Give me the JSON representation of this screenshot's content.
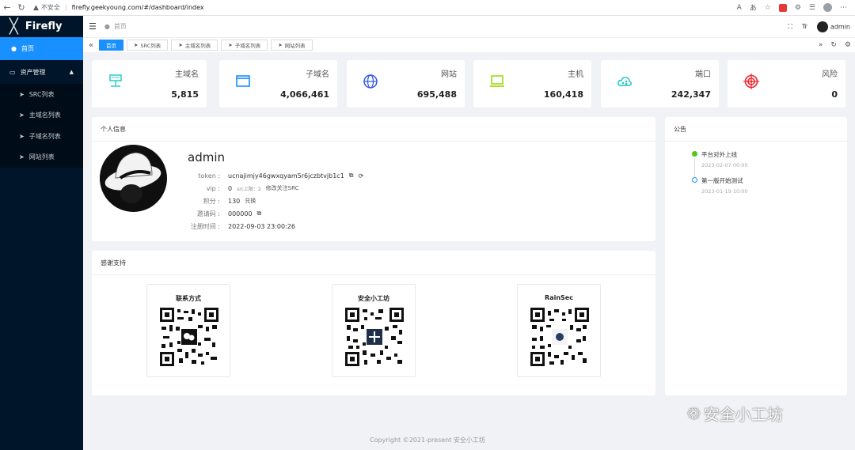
{
  "browser": {
    "back": "←",
    "reload": "↻",
    "warn": "▲",
    "insecure": "不安全",
    "url": "firefly.geekyoung.com/#/dashboard/index"
  },
  "sidebar": {
    "brand": "Firefly",
    "home": "首页",
    "group": "资产管理",
    "items": [
      {
        "label": "SRC列表"
      },
      {
        "label": "主域名列表"
      },
      {
        "label": "子域名列表"
      },
      {
        "label": "网站列表"
      }
    ]
  },
  "header": {
    "breadcrumb": "首页",
    "user": "admin",
    "tr": "Tr"
  },
  "tabs": [
    {
      "label": "首页",
      "active": true
    },
    {
      "label": "SRC列表"
    },
    {
      "label": "主域名列表"
    },
    {
      "label": "子域名列表"
    },
    {
      "label": "网站列表"
    }
  ],
  "stats": [
    {
      "label": "主域名",
      "value": "5,815",
      "color": "#36cfc9"
    },
    {
      "label": "子域名",
      "value": "4,066,461",
      "color": "#1890ff"
    },
    {
      "label": "网站",
      "value": "695,488",
      "color": "#2f54eb"
    },
    {
      "label": "主机",
      "value": "160,418",
      "color": "#a0d911"
    },
    {
      "label": "端口",
      "value": "242,347",
      "color": "#13c2c2"
    },
    {
      "label": "风险",
      "value": "0",
      "color": "#f5222d"
    }
  ],
  "profile": {
    "title": "个人信息",
    "name": "admin",
    "token_key": "token :",
    "token": "ucnajimjy46gwxqyam5r6jczbtvjb1c1",
    "vip_key": "vip :",
    "vip": "0",
    "src_limit": "src上限：2",
    "follow": "修改关注SRC",
    "points_key": "积分 :",
    "points": "130",
    "exchange": "兑换",
    "invite_key": "邀请码 :",
    "invite": "000000",
    "reg_key": "注册时间 :",
    "reg": "2022-09-03 23:00:26"
  },
  "thanks": {
    "title": "感谢支持",
    "qrs": [
      {
        "title": "联系方式"
      },
      {
        "title": "安全小工坊"
      },
      {
        "title": "RainSec"
      }
    ]
  },
  "notice": {
    "title": "公告",
    "items": [
      {
        "text": "平台对外上线",
        "date": "2023-02-07 00:00",
        "color": "#52c41a"
      },
      {
        "text": "第一版开始测试",
        "date": "2023-01-19 10:00",
        "color": "#1890ff"
      }
    ]
  },
  "footer": {
    "copyright": "Copyright ©2021-present 安全小工坊",
    "watermark": "安全小工坊"
  }
}
